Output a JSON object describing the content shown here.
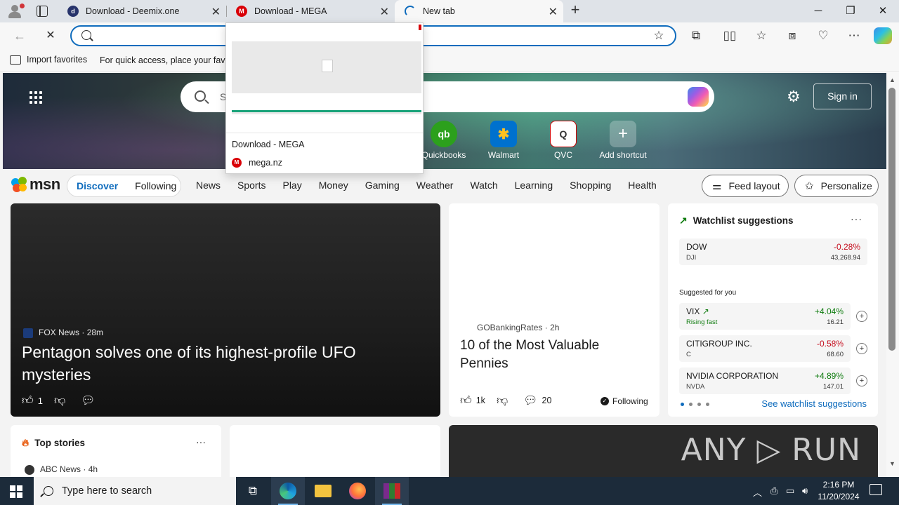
{
  "browser": {
    "tabs": [
      {
        "title": "Download - Deemix.one",
        "favicon": "deemix-icon"
      },
      {
        "title": "Download - MEGA",
        "favicon": "mega-icon"
      },
      {
        "title": "New tab",
        "favicon": "loading-spinner-icon",
        "active": true
      }
    ],
    "address_value": "",
    "favorites": {
      "import_label": "Import favorites",
      "hint": "For quick access, place your favorites here on the favorites bar."
    }
  },
  "tab_preview": {
    "title": "Download - MEGA",
    "domain": "mega.nz"
  },
  "newtab": {
    "search_placeholder": "Se",
    "sign_in": "Sign in",
    "shortcuts": [
      {
        "label": "Quickbooks",
        "icon": "qb"
      },
      {
        "label": "Walmart",
        "icon": "✱"
      },
      {
        "label": "QVC",
        "icon": "Q"
      },
      {
        "label": "Add shortcut",
        "icon": "+"
      }
    ],
    "brand": "msn",
    "segments": {
      "discover": "Discover",
      "following": "Following"
    },
    "categories": [
      "News",
      "Sports",
      "Play",
      "Money",
      "Gaming",
      "Weather",
      "Watch",
      "Learning",
      "Shopping",
      "Health"
    ],
    "feed_layout": "Feed layout",
    "personalize": "Personalize"
  },
  "hero_story": {
    "source": "FOX News",
    "age": "28m",
    "title": "Pentagon solves one of its highest-profile UFO mysteries",
    "likes": "1"
  },
  "mid_story": {
    "source": "GOBankingRates",
    "age": "2h",
    "title": "10 of the Most Valuable Pennies",
    "likes": "1k",
    "comments": "20",
    "following": "Following"
  },
  "watchlist": {
    "title": "Watchlist suggestions",
    "index": {
      "name": "DOW",
      "sub": "DJI",
      "change": "-0.28%",
      "price": "43,268.94"
    },
    "suggested_label": "Suggested for you",
    "stocks": [
      {
        "name": "VIX",
        "sub": "Rising fast",
        "change": "+4.04%",
        "price": "16.21"
      },
      {
        "name": "CITIGROUP INC.",
        "sub": "C",
        "change": "-0.58%",
        "price": "68.60"
      },
      {
        "name": "NVIDIA CORPORATION",
        "sub": "NVDA",
        "change": "+4.89%",
        "price": "147.01"
      }
    ],
    "see_more": "See watchlist suggestions"
  },
  "top_stories": {
    "title": "Top stories",
    "source": "ABC News",
    "age": "4h"
  },
  "watermark": "ANY ▷ RUN",
  "taskbar": {
    "search_placeholder": "Type here to search",
    "time": "2:16 PM",
    "date": "11/20/2024"
  },
  "colors": {
    "accent": "#0f6cbd",
    "negative": "#c50f1f",
    "positive": "#107c10",
    "mega_red": "#d90007"
  }
}
